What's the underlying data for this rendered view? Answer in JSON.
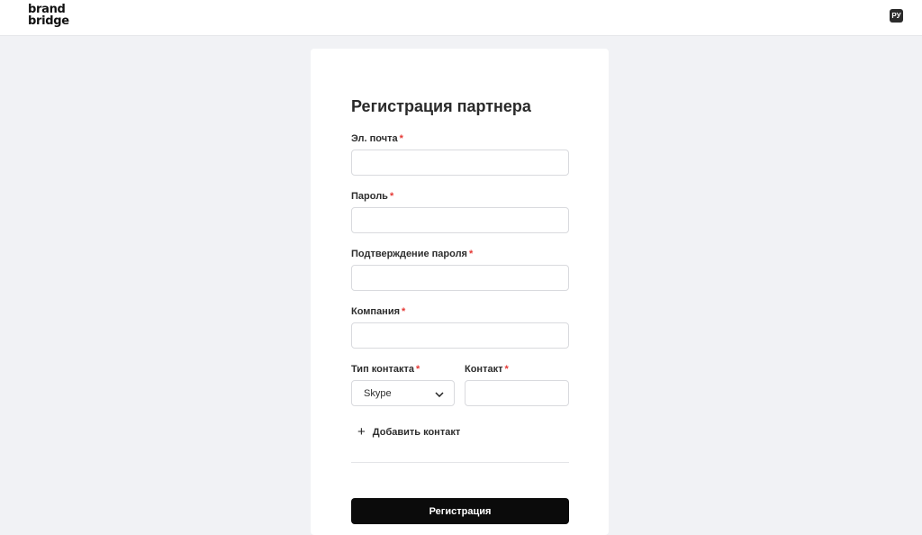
{
  "header": {
    "logo_line1": "brand",
    "logo_line2": "bridge",
    "lang_label": "РУ"
  },
  "form": {
    "title": "Регистрация партнера",
    "required_mark": "*",
    "fields": {
      "email": {
        "label": "Эл. почта",
        "value": ""
      },
      "password": {
        "label": "Пароль",
        "value": ""
      },
      "password_confirm": {
        "label": "Подтверждение пароля",
        "value": ""
      },
      "company": {
        "label": "Компания",
        "value": ""
      },
      "contact_type": {
        "label": "Тип контакта",
        "selected": "Skype"
      },
      "contact": {
        "label": "Контакт",
        "value": ""
      }
    },
    "add_contact_label": "Добавить контакт",
    "submit_label": "Регистрация"
  },
  "colors": {
    "background": "#f1f2f5",
    "required": "#e53935",
    "button": "#0b0b0b"
  },
  "icons": {
    "add": "plus-icon",
    "select": "chevron-down-icon"
  }
}
